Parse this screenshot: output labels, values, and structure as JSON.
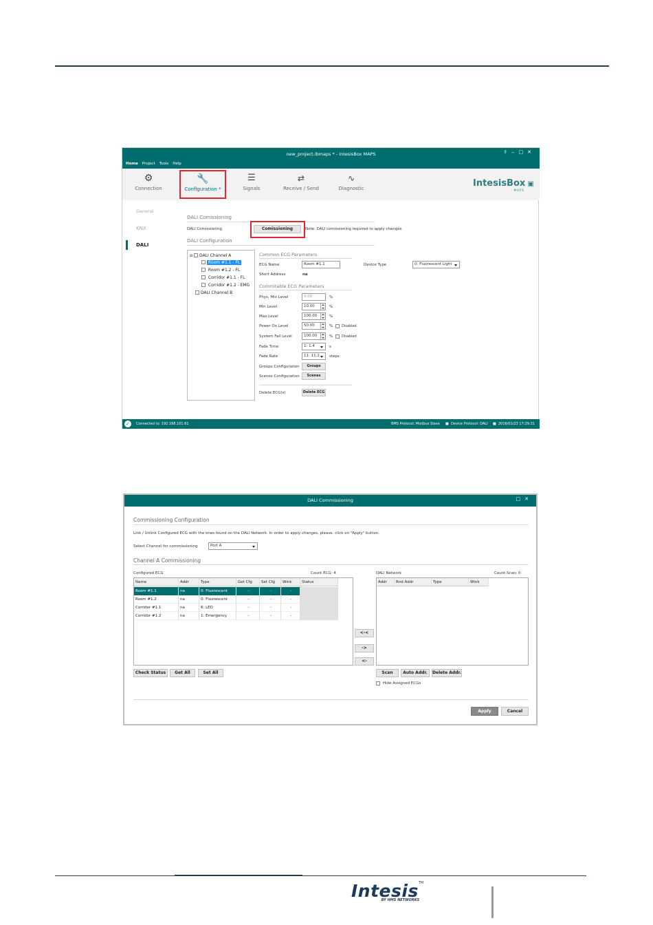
{
  "screen1": {
    "title": "new_project.ibmaps * - IntesisBox MAPS",
    "menu": [
      "Home",
      "Project",
      "Tools",
      "Help"
    ],
    "toolbar": [
      "Connection",
      "Configuration *",
      "Signals",
      "Receive / Send",
      "Diagnostic"
    ],
    "logo": "IntesisBox",
    "logo_sub": "MAPS",
    "sidebar": [
      "General",
      "KNX",
      "DALI"
    ],
    "commissioning": {
      "section": "DALI Comissioning",
      "label": "DALI Comissioning",
      "button": "Comissioning",
      "note": "Note: DALI comissioning required to apply changes"
    },
    "config_section": "DALI Configuration",
    "tree": {
      "channel_a": "DALI Channel A",
      "items": [
        "Room #1.1 - FL",
        "Room #1.2 - FL",
        "Corridor #1.1 - FL",
        "Corridor #1.2 - EMG"
      ],
      "channel_b": "DALI Channel B"
    },
    "common": {
      "section": "Common ECG Parameters",
      "ecg_name_label": "ECG Name",
      "ecg_name": "Room #1.1",
      "device_type_label": "Device Type",
      "device_type": "0: Fluorescent Light",
      "short_addr_label": "Short Address",
      "short_addr": "na"
    },
    "commit": {
      "section": "Commitable ECG Parameters",
      "phys_min_label": "Phys. Min Level",
      "phys_min": "0.00",
      "min_label": "Min Level",
      "min": "10.00",
      "max_label": "Max Level",
      "max": "100.00",
      "power_on_label": "Power On Level",
      "power_on": "50.00",
      "sys_fail_label": "System Fail Level",
      "sys_fail": "100.00",
      "disabled": "Disabled",
      "pct": "%",
      "fade_time_label": "Fade Time",
      "fade_time": "1: 1.4",
      "fade_time_unit": "s",
      "fade_rate_label": "Fade Rate",
      "fade_rate": "11: 11.2",
      "fade_rate_unit": "steps",
      "groups_label": "Groups Configuration",
      "groups_btn": "Groups",
      "scenes_label": "Scenes Configuration",
      "scenes_btn": "Scenes",
      "delete_label": "Delete ECG(s)",
      "delete_btn": "Delete ECG"
    },
    "status": {
      "connected": "Connected to: 192.168.101.61",
      "bms": "BMS Protocol: Modbus Slave",
      "device": "Device Protocol: DALI",
      "datetime": "2016/01/23 17:29:31"
    }
  },
  "screen2": {
    "title": "DALI Commissioning",
    "section": "Commissioning Configuration",
    "instructions": "Link / Unlink Configured ECG with the ones found on the DALI Network. In order to apply changes, please, click on \"Apply\" button.",
    "select_label": "Select Channel for commissioning",
    "port": "Port A",
    "channel_section": "Channel A Commissioning",
    "configured_label": "Configured ECG",
    "count_ecg": "Count ECG: 4",
    "left_headers": [
      "Name",
      "Addr",
      "Type",
      "Get Cfg",
      "Set Cfg",
      "Wink",
      "Status"
    ],
    "rows": [
      [
        "Room #1.1",
        "na",
        "0: Fluorescent",
        "-",
        "-",
        "-",
        ""
      ],
      [
        "Room #1.2",
        "na",
        "0: Fluorescent",
        "-",
        "-",
        "-",
        ""
      ],
      [
        "Corridor #1.1",
        "na",
        "6: LED",
        "-",
        "-",
        "-",
        ""
      ],
      [
        "Corridor #1.2",
        "na",
        "1: Emergency",
        "-",
        "-",
        "-",
        ""
      ]
    ],
    "network_label": "DALI Network",
    "count_scan": "Count Scan: 0",
    "right_headers": [
      "Addr",
      "Rnd Addr",
      "Type",
      "Wink"
    ],
    "arrows": [
      "<-<",
      "->",
      "<-"
    ],
    "left_buttons": [
      "Check Status",
      "Get All",
      "Set All"
    ],
    "right_buttons": [
      "Scan",
      "Auto Addr.",
      "Delete Addr."
    ],
    "hide_assigned": "Hide Assigned ECGs",
    "apply": "Apply",
    "cancel": "Cancel"
  },
  "footer": {
    "logo": "Intesis",
    "tm": "TM",
    "sub": "BY HMS NETWORKS"
  },
  "colors": {
    "teal": "#006e6e",
    "highlight": "#e2262c",
    "selected": "#006e6e"
  }
}
